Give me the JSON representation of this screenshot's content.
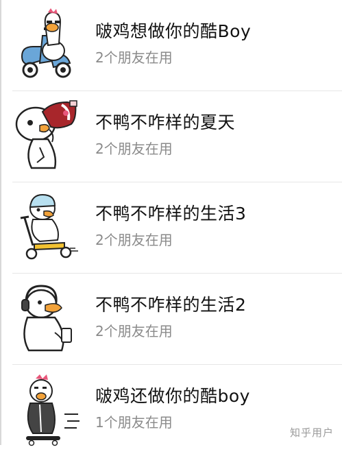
{
  "sticker_list": [
    {
      "title": "啵鸡想做你的酷Boy",
      "subtitle": "2个朋友在用",
      "icon": "goose-on-scooter-icon"
    },
    {
      "title": "不鸭不咋样的夏天",
      "subtitle": "2个朋友在用",
      "icon": "duck-drinking-cola-icon"
    },
    {
      "title": "不鸭不咋样的生活3",
      "subtitle": "2个朋友在用",
      "icon": "duck-kick-scooter-icon"
    },
    {
      "title": "不鸭不咋样的生活2",
      "subtitle": "2个朋友在用",
      "icon": "duck-headphones-icon"
    },
    {
      "title": "啵鸡还做你的酷boy",
      "subtitle": "1个朋友在用",
      "icon": "goose-skateboard-icon"
    }
  ],
  "watermark": "知乎用户",
  "colors": {
    "title": "#111111",
    "subtitle": "#8a8a8a",
    "divider": "#e6e6e6",
    "scooter_blue": "#6aa6d8",
    "scooter_yellow": "#f2c232",
    "cola_red": "#a8262b",
    "comb_pink": "#e8577a"
  }
}
